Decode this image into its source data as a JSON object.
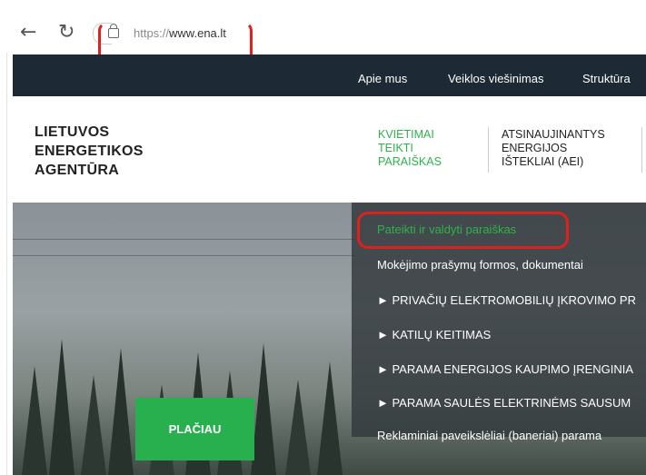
{
  "browser": {
    "back_icon": "arrow-left-icon",
    "reload_icon": "reload-icon",
    "url_proto": "https://",
    "url_host": "www.ena.lt"
  },
  "topnav": {
    "items": [
      "Apie mus",
      "Veiklos viešinimas",
      "Struktūra"
    ]
  },
  "header": {
    "logo": "LIETUVOS\nENERGETIKOS\nAGENTŪRA",
    "menu": [
      "KVIETIMAI\nTEIKTI\nPARAIŠKAS",
      "ATSINAUJINANTYS\nENERGIJOS\nIŠTEKLIAI (AEI)"
    ]
  },
  "dropdown": {
    "items": [
      "Pateikti ir valdyti paraiškas",
      "Mokėjimo prašymų formos, dokumentai",
      "► PRIVAČIŲ ELEKTROMOBILIŲ ĮKROVIMO PR",
      "► KATILŲ KEITIMAS",
      "► PARAMA ENERGIJOS KAUPIMO ĮRENGINIA",
      "► PARAMA SAULĖS ELEKTRINĖMS SAUSUM",
      "Reklaminiai paveikslėliai (baneriai) parama"
    ]
  },
  "hero": {
    "button": "PLAČIAU"
  },
  "colors": {
    "accent_green": "#2db34a",
    "nav_bg": "#1d2a35",
    "annotation_red": "#e0201b"
  }
}
